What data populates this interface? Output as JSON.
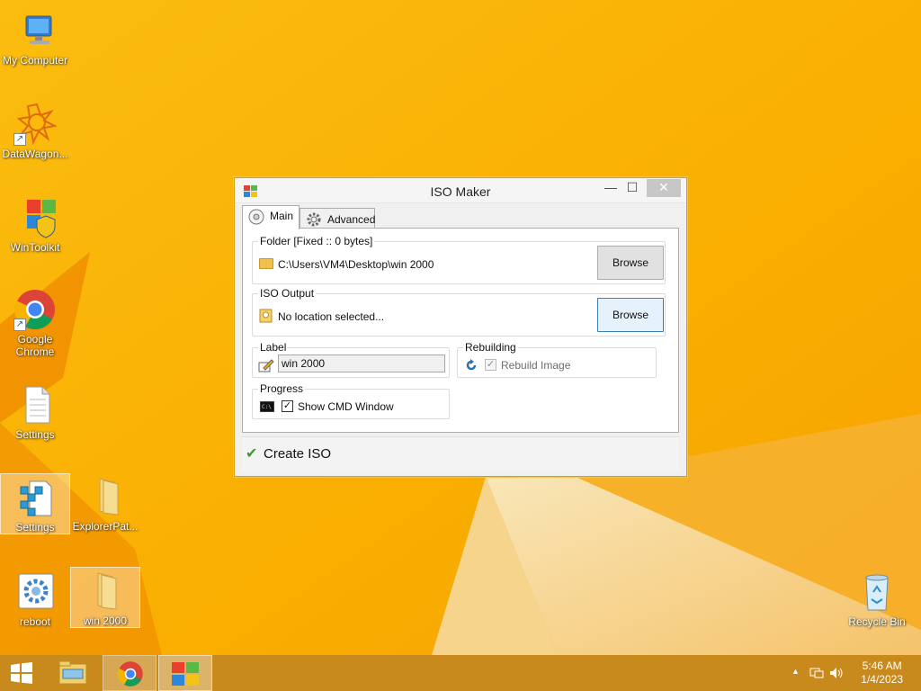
{
  "desktop": {
    "icons": [
      {
        "label": "My Computer"
      },
      {
        "label": "DataWagon..."
      },
      {
        "label": "WinToolkit"
      },
      {
        "label": "Google Chrome"
      },
      {
        "label": "Settings"
      },
      {
        "label": "Settings"
      },
      {
        "label": "ExplorerPat..."
      },
      {
        "label": "reboot"
      },
      {
        "label": "win 2000"
      },
      {
        "label": "Recycle Bin"
      }
    ]
  },
  "window": {
    "title": "ISO Maker",
    "controls": {
      "minimize": "—",
      "maximize": "☐",
      "close": "✕"
    },
    "tabs": [
      {
        "label": "Main",
        "active": true
      },
      {
        "label": "Advanced",
        "active": false
      }
    ],
    "folder_group": {
      "legend": "Folder [Fixed :: 0 bytes]",
      "path": "C:\\Users\\VM4\\Desktop\\win 2000",
      "browse_label": "Browse"
    },
    "iso_output_group": {
      "legend": "ISO Output",
      "path": "No location selected...",
      "browse_label": "Browse"
    },
    "label_group": {
      "legend": "Label",
      "value": "win 2000"
    },
    "rebuilding_group": {
      "legend": "Rebuilding",
      "checkbox_label": "Rebuild Image",
      "checked": true,
      "enabled": false
    },
    "progress_group": {
      "legend": "Progress",
      "checkbox_label": "Show CMD Window",
      "checked": true
    },
    "create_button": "Create ISO",
    "check_glyph": "✔"
  },
  "taskbar": {
    "clock_time": "5:46 AM",
    "clock_date": "1/4/2023",
    "tray_up_arrow": "▲"
  }
}
